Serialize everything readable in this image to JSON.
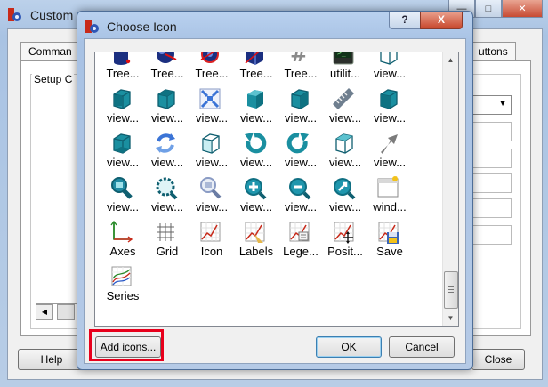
{
  "background_window": {
    "title": "Custom",
    "tabs": [
      {
        "label": "Comman"
      },
      {
        "label": "uttons"
      }
    ],
    "group_label": "Setup C",
    "help_label": "Help",
    "close_label": "Close"
  },
  "dialog": {
    "title": "Choose Icon",
    "help_button": "?",
    "close_button": "X",
    "icons": [
      {
        "label": "Tree...",
        "icon": "tree-cylinder-icon"
      },
      {
        "label": "Tree...",
        "icon": "tree-sphere-icon"
      },
      {
        "label": "Tree...",
        "icon": "tree-disc-icon"
      },
      {
        "label": "Tree...",
        "icon": "tree-box-icon"
      },
      {
        "label": "Tree...",
        "icon": "hash-icon"
      },
      {
        "label": "utilit...",
        "icon": "terminal-icon"
      },
      {
        "label": "view...",
        "icon": "wire-cube-icon"
      },
      {
        "label": "view...",
        "icon": "cube-front-icon"
      },
      {
        "label": "view...",
        "icon": "cube-top-icon"
      },
      {
        "label": "view...",
        "icon": "fit-all-icon"
      },
      {
        "label": "view...",
        "icon": "solid-cube-icon"
      },
      {
        "label": "view...",
        "icon": "cube-right-icon"
      },
      {
        "label": "view...",
        "icon": "measure-icon"
      },
      {
        "label": "view...",
        "icon": "cube-rear-icon"
      },
      {
        "label": "view...",
        "icon": "cube-bottom-icon"
      },
      {
        "label": "view...",
        "icon": "refresh-icon"
      },
      {
        "label": "view...",
        "icon": "cube-left-icon"
      },
      {
        "label": "view...",
        "icon": "rotate-left-icon"
      },
      {
        "label": "view...",
        "icon": "rotate-right-icon"
      },
      {
        "label": "view...",
        "icon": "cube-iso-icon"
      },
      {
        "label": "view...",
        "icon": "arrow-icon"
      },
      {
        "label": "view...",
        "icon": "zoom-box-icon"
      },
      {
        "label": "view...",
        "icon": "zoom-select-icon"
      },
      {
        "label": "view...",
        "icon": "zoom-icon"
      },
      {
        "label": "view...",
        "icon": "zoom-in-icon"
      },
      {
        "label": "view...",
        "icon": "zoom-out-icon"
      },
      {
        "label": "view...",
        "icon": "zoom-pointer-icon"
      },
      {
        "label": "wind...",
        "icon": "window-icon"
      },
      {
        "label": "Axes",
        "icon": "axes-icon"
      },
      {
        "label": "Grid",
        "icon": "grid-icon"
      },
      {
        "label": "Icon",
        "icon": "plot-icon"
      },
      {
        "label": "Labels",
        "icon": "plot-labels-icon"
      },
      {
        "label": "Lege...",
        "icon": "plot-legend-icon"
      },
      {
        "label": "Posit...",
        "icon": "plot-position-icon"
      },
      {
        "label": "Save",
        "icon": "plot-save-icon"
      },
      {
        "label": "Series",
        "icon": "plot-series-icon"
      }
    ],
    "add_icons_label": "Add icons...",
    "ok_label": "OK",
    "cancel_label": "Cancel"
  },
  "colors": {
    "icon_teal": "#1a8fa0",
    "icon_navy": "#1b2f80",
    "highlight": "#e8001c"
  }
}
